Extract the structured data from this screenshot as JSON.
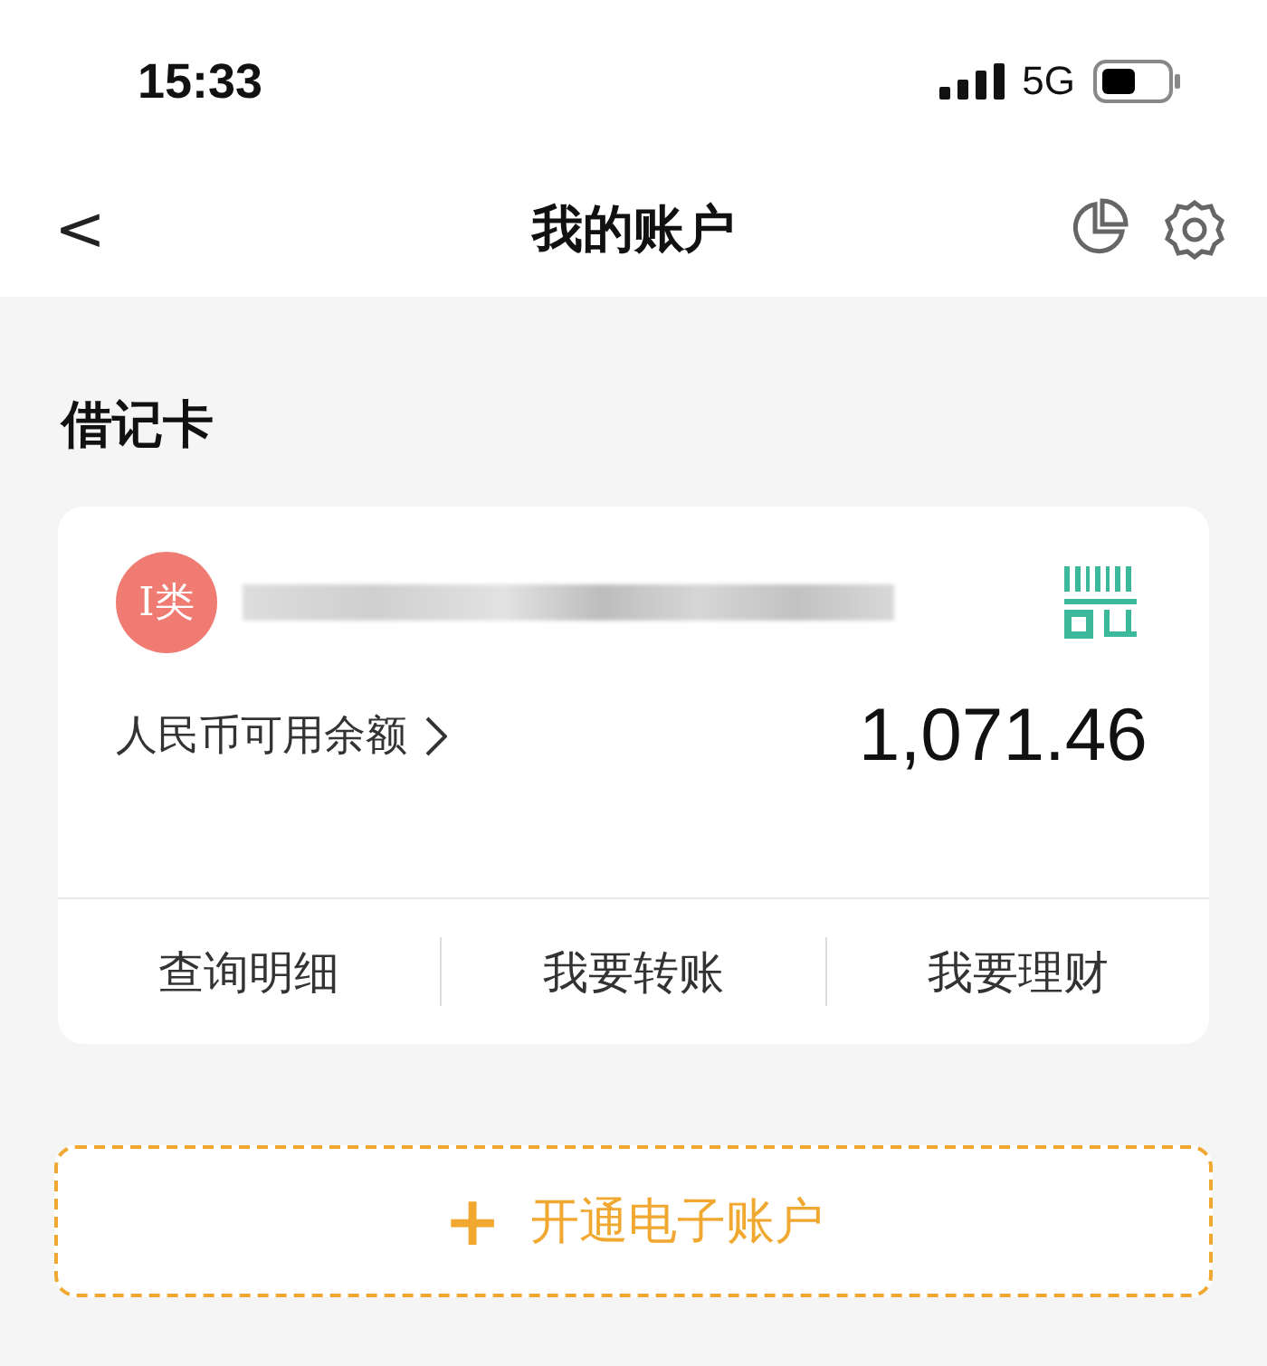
{
  "status_bar": {
    "time": "15:33",
    "network": "5G"
  },
  "nav": {
    "back": "<",
    "title": "我的账户"
  },
  "section_title": "借记卡",
  "card": {
    "badge": "I类",
    "balance_label": "人民币可用余额",
    "balance": "1,071.46",
    "actions": [
      "查询明细",
      "我要转账",
      "我要理财"
    ]
  },
  "open_account": {
    "icon": "+",
    "label": "开通电子账户"
  }
}
